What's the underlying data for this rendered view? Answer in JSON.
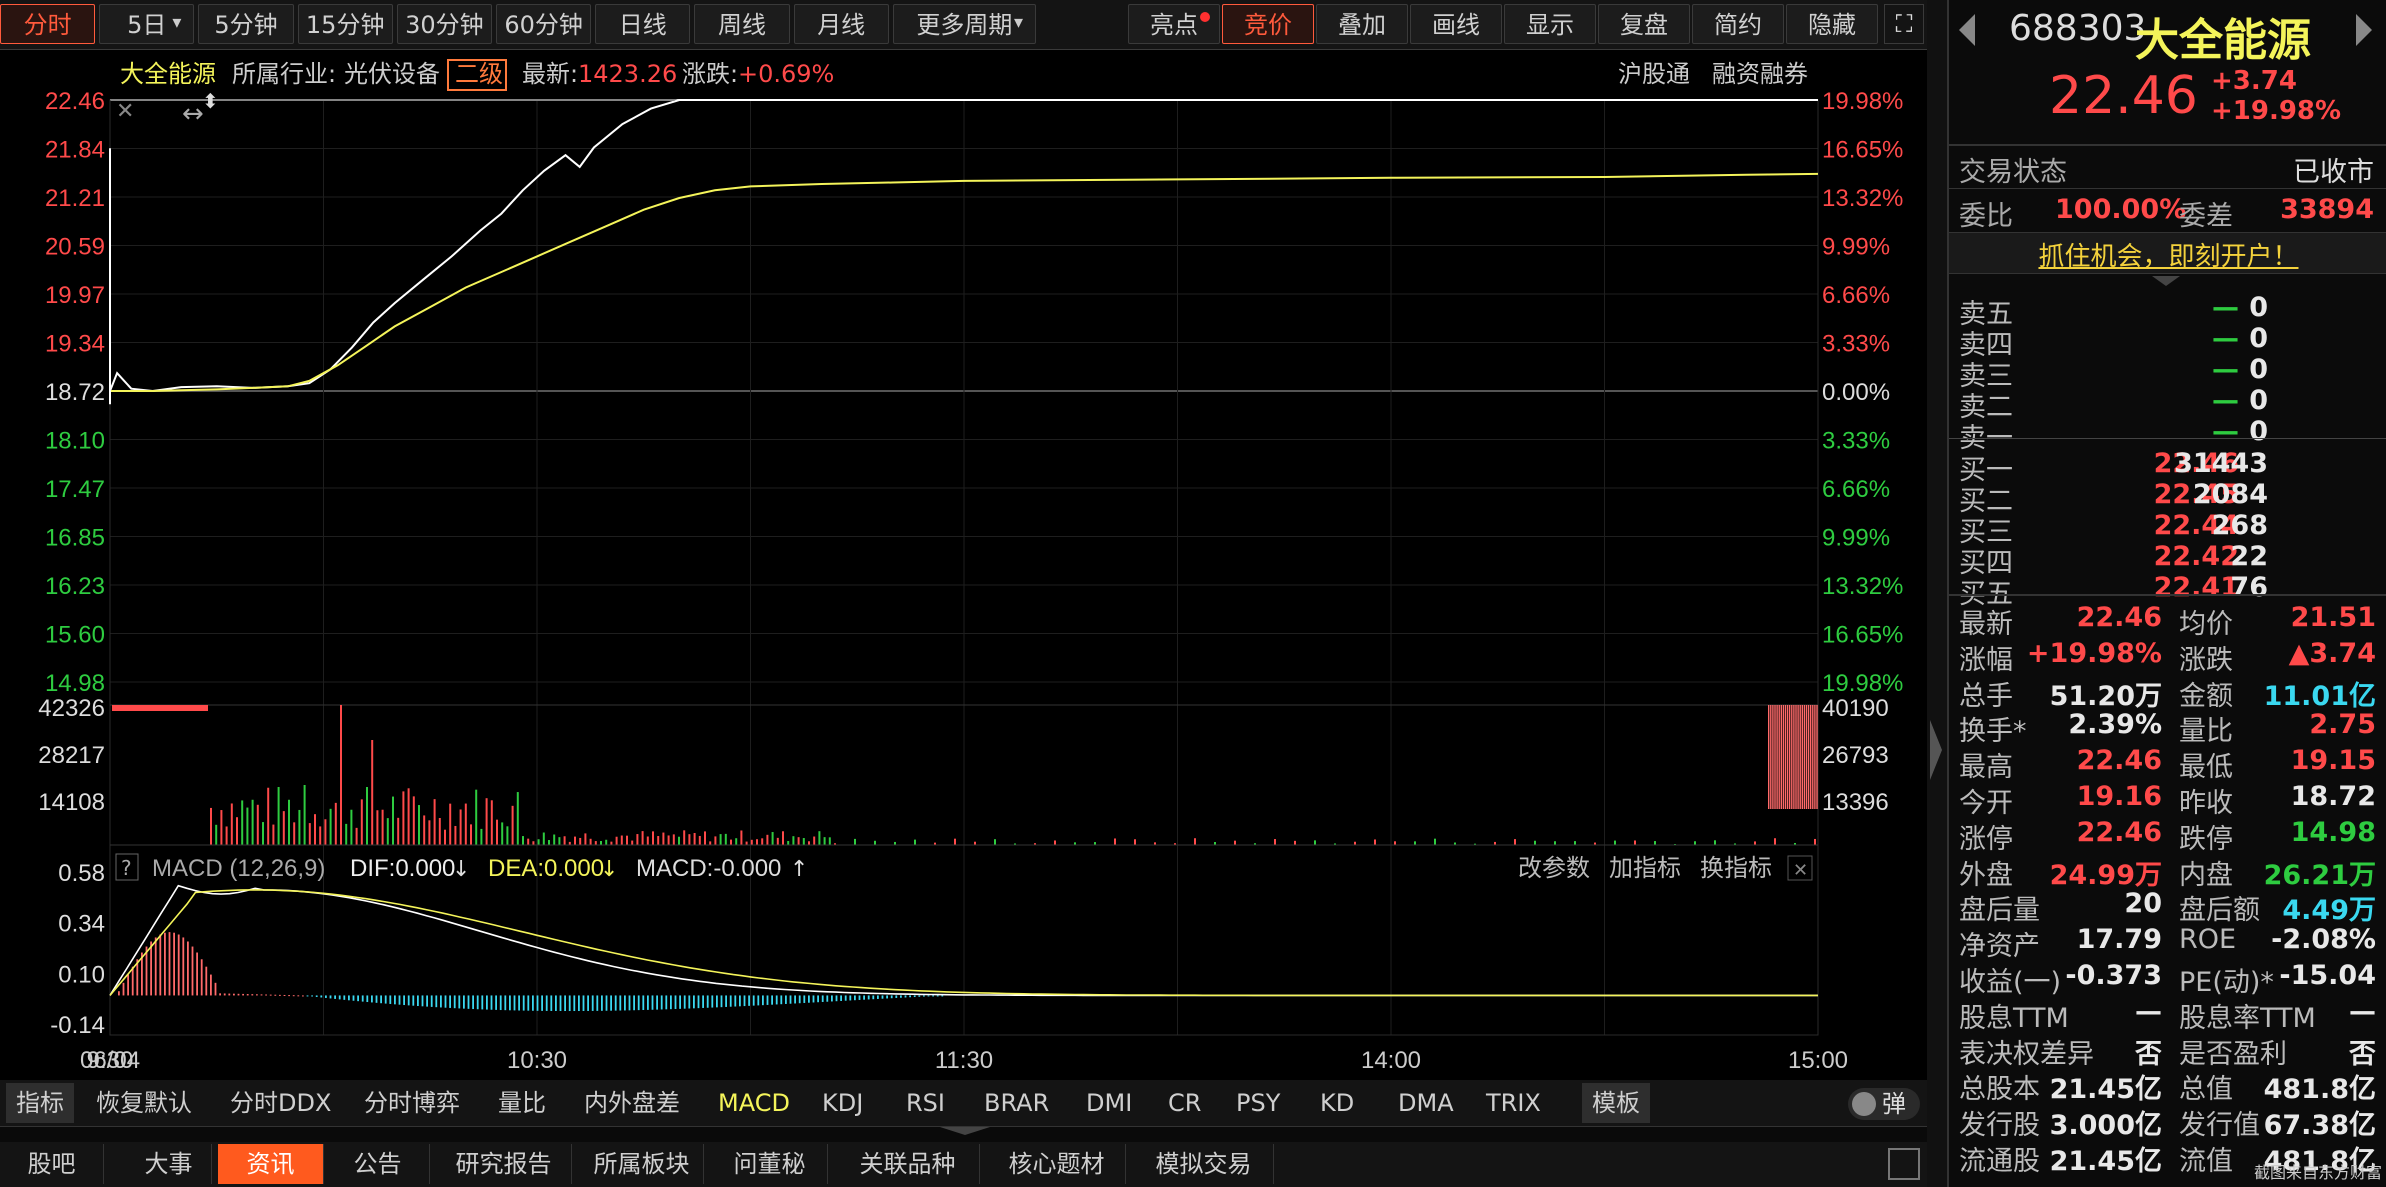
{
  "period_tabs": [
    "分时",
    "5日",
    "5分钟",
    "15分钟",
    "30分钟",
    "60分钟",
    "日线",
    "周线",
    "月线",
    "更多周期"
  ],
  "tool_buttons": [
    "亮点",
    "竞价",
    "叠加",
    "画线",
    "显示",
    "复盘",
    "简约",
    "隐藏"
  ],
  "info": {
    "name": "大全能源",
    "industry_label": "所属行业:",
    "industry": "光伏设备",
    "level": "二级",
    "latest_label": "最新:",
    "latest": "1423.26",
    "change_label": "涨跌:",
    "change": "+0.69%",
    "hgt": "沪股通",
    "rzrq": "融资融券"
  },
  "colors": {
    "up": "#ff4a4a",
    "down": "#2ecc40",
    "price_line": "#ffffff",
    "avg_line": "#f4f45a",
    "dif": "#ffffff",
    "dea": "#f4f45a",
    "neg_bar": "#3ad8f0"
  },
  "price_axis_left": [
    "22.46",
    "21.84",
    "21.21",
    "20.59",
    "19.97",
    "19.34",
    "18.72",
    "18.10",
    "17.47",
    "16.85",
    "16.23",
    "15.60",
    "14.98"
  ],
  "pct_axis_right": [
    "19.98%",
    "16.65%",
    "13.32%",
    "9.99%",
    "6.66%",
    "3.33%",
    "0.00%",
    "3.33%",
    "6.66%",
    "9.99%",
    "13.32%",
    "16.65%",
    "19.98%"
  ],
  "vol_axis_left": [
    "42326",
    "28217",
    "14108"
  ],
  "vol_axis_right": [
    "40190",
    "26793",
    "13396"
  ],
  "macd": {
    "title": "MACD (12,26,9)",
    "dif": "DIF:0.000",
    "dea": "DEA:0.000",
    "macd": "MACD:-0.000",
    "axis": [
      "0.58",
      "0.34",
      "0.10",
      "-0.14"
    ],
    "actions": [
      "改参数",
      "加指标",
      "换指标"
    ]
  },
  "time_axis": [
    "06/04",
    "9:30",
    "10:30",
    "11:30",
    "14:00",
    "15:00"
  ],
  "indicator_tabs": [
    "指标",
    "恢复默认",
    "分时DDX",
    "分时博弈",
    "量比",
    "内外盘差",
    "MACD",
    "KDJ",
    "RSI",
    "BRAR",
    "DMI",
    "CR",
    "PSY",
    "KD",
    "DMA",
    "TRIX",
    "模板"
  ],
  "indicator_active": "MACD",
  "toggle_label": "弹",
  "bottom_tabs": [
    "股吧",
    "大事",
    "资讯",
    "公告",
    "研究报告",
    "所属板块",
    "问董秘",
    "关联品种",
    "核心题材",
    "模拟交易"
  ],
  "bottom_active": "资讯",
  "chart_data": {
    "type": "line",
    "price_series": [
      18.72,
      18.95,
      18.75,
      18.72,
      18.77,
      18.78,
      18.76,
      18.78,
      18.82,
      19.0,
      19.28,
      19.6,
      19.85,
      20.15,
      20.45,
      20.78,
      21.0,
      21.3,
      21.55,
      21.75,
      21.6,
      21.85,
      22.15,
      22.35,
      22.46,
      22.46,
      22.46,
      22.46
    ],
    "price_times": [
      "09:30",
      "09:31",
      "09:33",
      "09:36",
      "09:40",
      "09:45",
      "09:50",
      "09:55",
      "09:58",
      "10:01",
      "10:04",
      "10:07",
      "10:10",
      "10:14",
      "10:18",
      "10:22",
      "10:25",
      "10:28",
      "10:31",
      "10:34",
      "10:36",
      "10:38",
      "10:42",
      "10:46",
      "10:50",
      "11:00",
      "13:30",
      "15:00"
    ],
    "avg_series": [
      18.72,
      18.72,
      18.73,
      18.74,
      18.76,
      18.78,
      18.85,
      19.05,
      19.3,
      19.55,
      19.8,
      20.05,
      20.25,
      20.45,
      20.65,
      20.85,
      21.05,
      21.2,
      21.3,
      21.35,
      21.38,
      21.4,
      21.42,
      21.44,
      21.46,
      21.47,
      21.5,
      21.51
    ],
    "avg_times": [
      "09:30",
      "09:36",
      "09:40",
      "09:45",
      "09:50",
      "09:55",
      "09:58",
      "10:02",
      "10:06",
      "10:10",
      "10:15",
      "10:20",
      "10:25",
      "10:30",
      "10:35",
      "10:40",
      "10:45",
      "10:50",
      "10:55",
      "11:00",
      "11:10",
      "11:20",
      "11:30",
      "13:30",
      "14:00",
      "14:30",
      "14:50",
      "15:00"
    ],
    "ylim": [
      14.98,
      22.46
    ],
    "prev_close": 18.72,
    "volume": {
      "ylim": [
        0,
        42326
      ]
    },
    "macd": {
      "ylim": [
        -0.14,
        0.58
      ]
    }
  },
  "quote": {
    "code": "688303",
    "name": "大全能源",
    "price": "22.46",
    "change": "+3.74",
    "change_pct": "+19.98%"
  },
  "status": {
    "label": "交易状态",
    "value": "已收市"
  },
  "commission": {
    "ratio_label": "委比",
    "ratio": "100.00%",
    "diff_label": "委差",
    "diff": "33894"
  },
  "promo": "抓住机会，即刻开户！",
  "sell_orders": [
    {
      "label": "卖五",
      "price": "—",
      "vol": "0"
    },
    {
      "label": "卖四",
      "price": "—",
      "vol": "0"
    },
    {
      "label": "卖三",
      "price": "—",
      "vol": "0"
    },
    {
      "label": "卖二",
      "price": "—",
      "vol": "0"
    },
    {
      "label": "卖一",
      "price": "—",
      "vol": "0"
    }
  ],
  "buy_orders": [
    {
      "label": "买一",
      "price": "22.46",
      "vol": "31443"
    },
    {
      "label": "买二",
      "price": "22.45",
      "vol": "2084"
    },
    {
      "label": "买三",
      "price": "22.44",
      "vol": "268"
    },
    {
      "label": "买四",
      "price": "22.42",
      "vol": "22"
    },
    {
      "label": "买五",
      "price": "22.41",
      "vol": "76"
    }
  ],
  "stats": [
    {
      "l1": "最新",
      "v1": "22.46",
      "c1": "red",
      "l2": "均价",
      "v2": "21.51",
      "c2": "red"
    },
    {
      "l1": "涨幅",
      "v1": "+19.98%",
      "c1": "red",
      "l2": "涨跌",
      "v2": "▲3.74",
      "c2": "red"
    },
    {
      "l1": "总手",
      "v1": "51.20万",
      "c1": "white",
      "l2": "金额",
      "v2": "11.01亿",
      "c2": "cyan"
    },
    {
      "l1": "换手*",
      "v1": "2.39%",
      "c1": "white",
      "l2": "量比",
      "v2": "2.75",
      "c2": "red"
    },
    {
      "l1": "最高",
      "v1": "22.46",
      "c1": "red",
      "l2": "最低",
      "v2": "19.15",
      "c2": "red"
    },
    {
      "l1": "今开",
      "v1": "19.16",
      "c1": "red",
      "l2": "昨收",
      "v2": "18.72",
      "c2": "white"
    },
    {
      "l1": "涨停",
      "v1": "22.46",
      "c1": "red",
      "l2": "跌停",
      "v2": "14.98",
      "c2": "green"
    },
    {
      "l1": "外盘",
      "v1": "24.99万",
      "c1": "red",
      "l2": "内盘",
      "v2": "26.21万",
      "c2": "green"
    },
    {
      "l1": "盘后量",
      "v1": "20",
      "c1": "white",
      "l2": "盘后额",
      "v2": "4.49万",
      "c2": "cyan"
    },
    {
      "l1": "净资产",
      "v1": "17.79",
      "c1": "white",
      "l2": "ROE",
      "v2": "-2.08%",
      "c2": "white"
    },
    {
      "l1": "收益(一)",
      "v1": "-0.373",
      "c1": "white",
      "l2": "PE(动)*",
      "v2": "-15.04",
      "c2": "white"
    },
    {
      "l1": "股息TTM",
      "v1": "—",
      "c1": "white",
      "l2": "股息率TTM",
      "v2": "—",
      "c2": "white"
    },
    {
      "l1": "表决权差异",
      "v1": "否",
      "c1": "white",
      "l2": "是否盈利",
      "v2": "否",
      "c2": "white"
    },
    {
      "l1": "总股本",
      "v1": "21.45亿",
      "c1": "white",
      "l2": "总值",
      "v2": "481.8亿",
      "c2": "white"
    },
    {
      "l1": "发行股",
      "v1": "3.000亿",
      "c1": "white",
      "l2": "发行值",
      "v2": "67.38亿",
      "c2": "white"
    },
    {
      "l1": "流通股",
      "v1": "21.45亿",
      "c1": "white",
      "l2": "流值",
      "v2": "481.8亿",
      "c2": "white"
    }
  ],
  "watermark": "截图来自东方财富"
}
